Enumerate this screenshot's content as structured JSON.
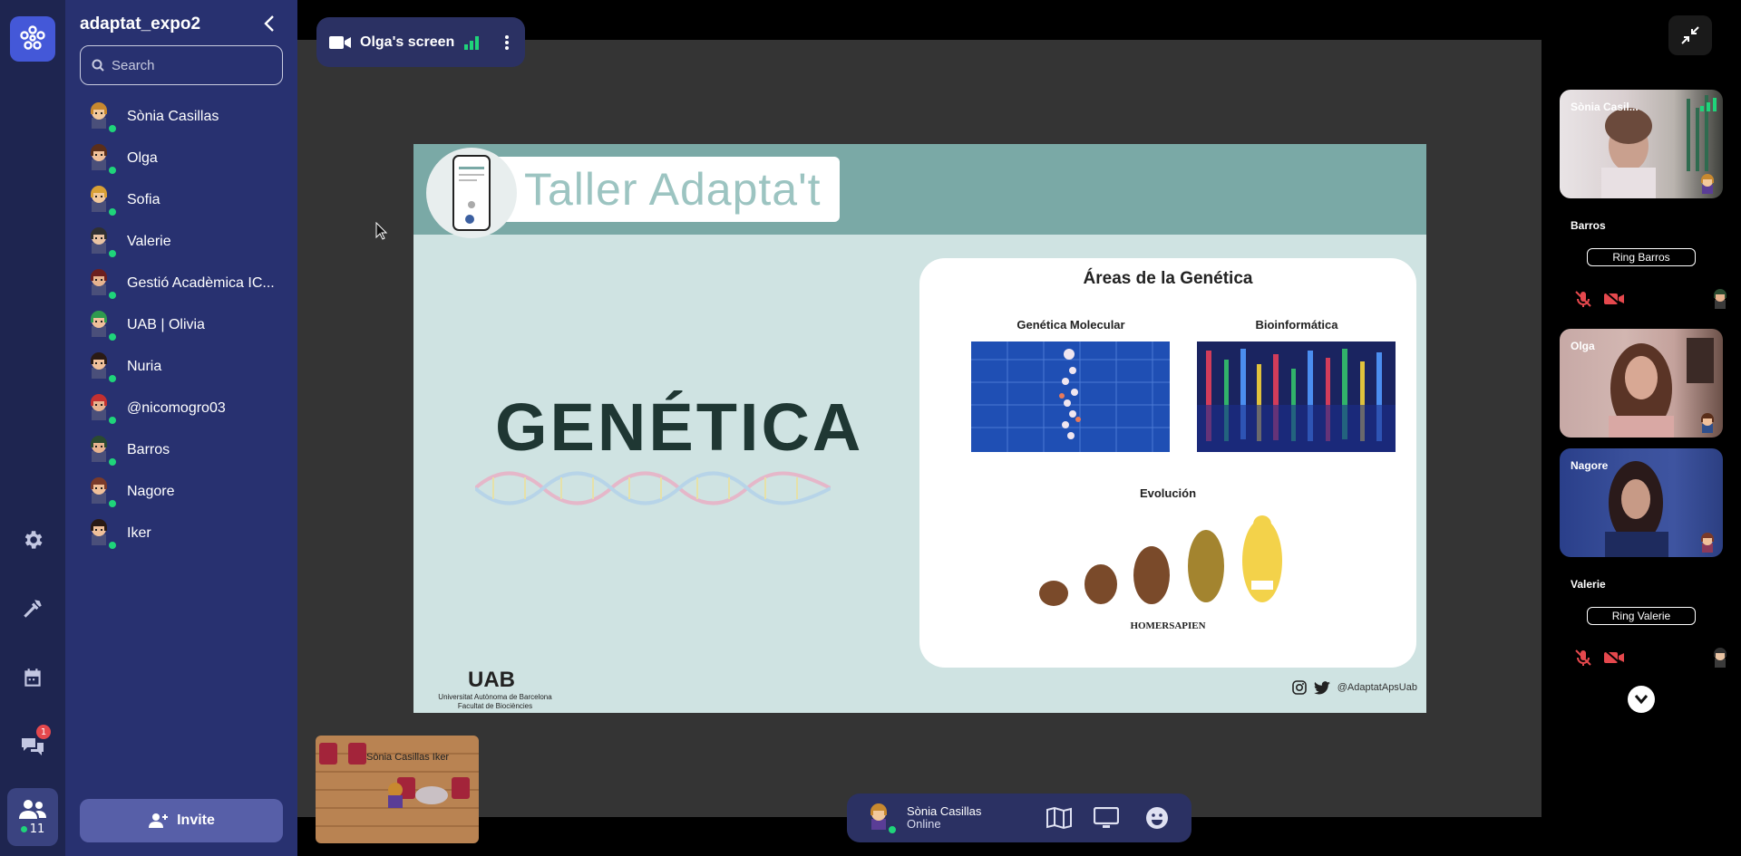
{
  "space": {
    "title": "adaptat_expo2"
  },
  "search": {
    "placeholder": "Search"
  },
  "members": [
    {
      "name": "Sònia Casillas",
      "hair": "#c8892f",
      "skin": "#f2c89b"
    },
    {
      "name": "Olga",
      "hair": "#5a2e1a",
      "skin": "#f0c09a"
    },
    {
      "name": "Sofia",
      "hair": "#d9a035",
      "skin": "#f2c89b"
    },
    {
      "name": "Valerie",
      "hair": "#303030",
      "skin": "#e9c3a3"
    },
    {
      "name": "Gestió Acadèmica IC...",
      "hair": "#6b1f1f",
      "skin": "#e7b38f"
    },
    {
      "name": "UAB | Olivia",
      "hair": "#2f9a4e",
      "skin": "#f0c09a"
    },
    {
      "name": "Nuria",
      "hair": "#2a1a14",
      "skin": "#f0c09a"
    },
    {
      "name": "@nicomogro03",
      "hair": "#c43030",
      "skin": "#e7b38f"
    },
    {
      "name": "Barros",
      "hair": "#2b4a30",
      "skin": "#e7b38f"
    },
    {
      "name": "Nagore",
      "hair": "#7a3a2a",
      "skin": "#f0c09a"
    },
    {
      "name": "Iker",
      "hair": "#2a1a14",
      "skin": "#f0c09a"
    }
  ],
  "invite": {
    "label": "Invite"
  },
  "rail": {
    "chat_badge": "1",
    "people_count": "11"
  },
  "screen_share": {
    "label": "Olga's screen"
  },
  "slide": {
    "header_title": "Taller Adapta't",
    "main_word": "GENÉTICA",
    "card_title": "Áreas de la Genética",
    "label_molecular": "Genética Molecular",
    "label_bioinfo": "Bioinformática",
    "label_evolution": "Evolución",
    "homer_caption": "HOMERSAPIEN",
    "uab_logo": "UAB",
    "uab_line1": "Universitat Autònoma de Barcelona",
    "uab_line2": "Facultat de Biociències",
    "social_handle": "@AdaptatApsUab"
  },
  "minimap": {
    "label": "Sònia Casillas Iker"
  },
  "me": {
    "name": "Sònia Casillas",
    "status": "Online"
  },
  "participants": {
    "tile1_name": "Sònia Casil...",
    "barros_name": "Barros",
    "barros_ring": "Ring Barros",
    "olga_name": "Olga",
    "nagore_name": "Nagore",
    "valerie_name": "Valerie",
    "valerie_ring": "Ring Valerie"
  },
  "colors": {
    "rail_bg": "#1e2550",
    "sidebar_bg": "#283170",
    "accent": "#4458d8",
    "online": "#1fd47a",
    "muted_red": "#e5484d"
  }
}
